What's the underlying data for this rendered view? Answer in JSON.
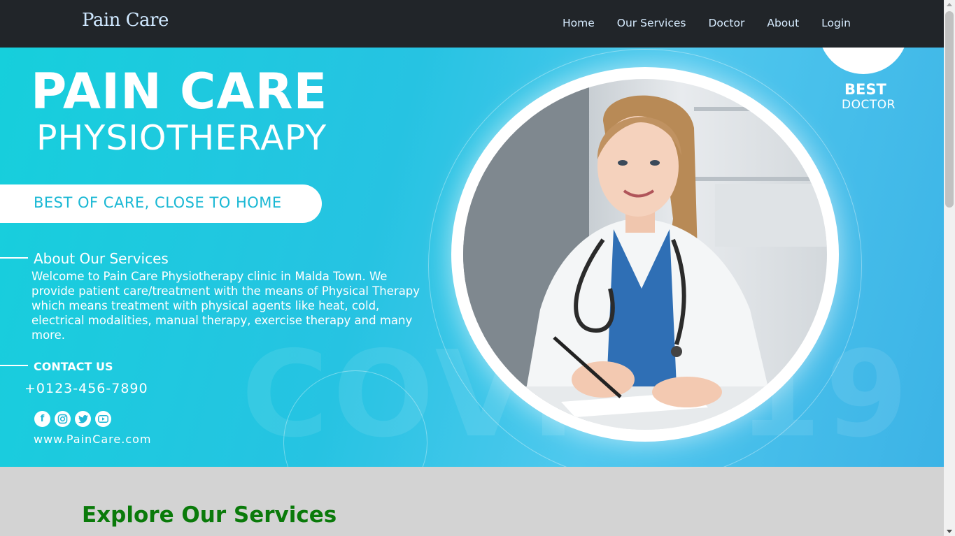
{
  "nav": {
    "brand": "Pain Care",
    "links": [
      "Home",
      "Our Services",
      "Doctor",
      "About",
      "Login"
    ]
  },
  "hero": {
    "title_line1": "PAIN CARE",
    "title_line2": "PHYSIOTHERAPY",
    "tagline": "BEST OF CARE, CLOSE TO HOME",
    "about_heading": "About Our Services",
    "about_text": "Welcome to Pain Care Physiotherapy clinic in Malda Town. We provide patient care/treatment with the means of Physical Therapy which means treatment with physical agents like heat, cold, electrical modalities, manual therapy, exercise therapy and many more.",
    "contact_heading": "CONTACT US",
    "phone": "+0123-456-7890",
    "website": "www.PainCare.com",
    "badge_line1": "BEST",
    "badge_line2": "DOCTOR",
    "watermark": "COVID-19",
    "socials": [
      "facebook-icon",
      "instagram-icon",
      "twitter-icon",
      "youtube-icon"
    ]
  },
  "services": {
    "heading": "Explore Our Services"
  },
  "colors": {
    "navbar_bg": "#212529",
    "hero_accent": "#26c3e2",
    "services_heading": "#0a7a0a",
    "page_bg": "#d3d3d3"
  }
}
